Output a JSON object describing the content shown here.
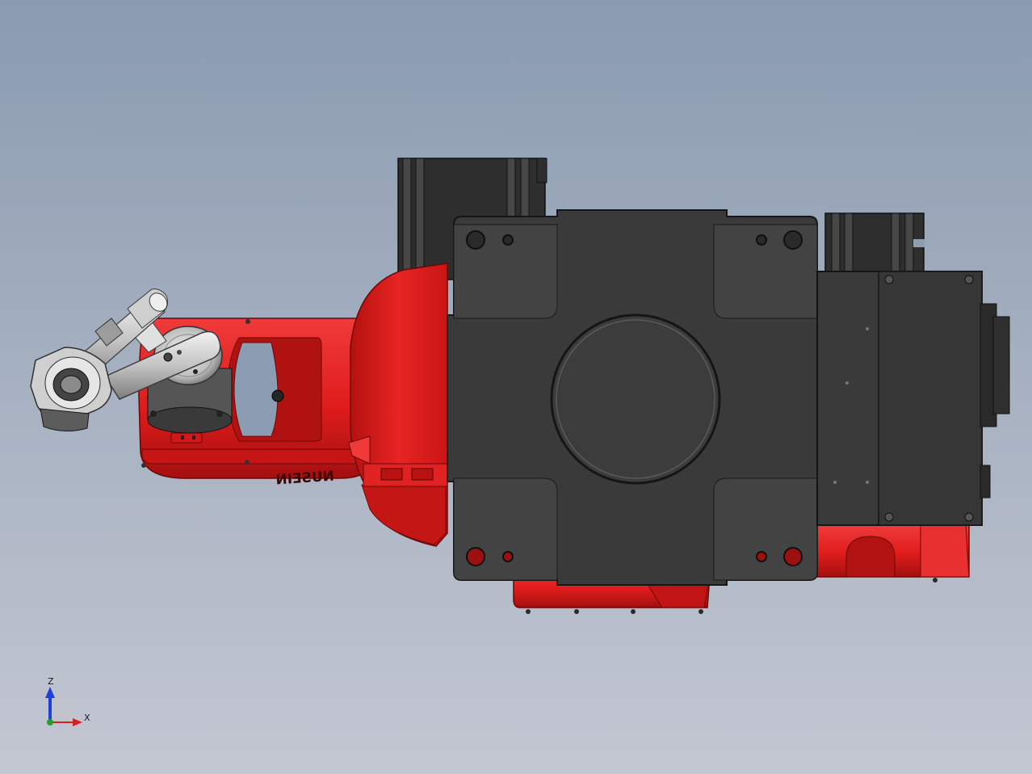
{
  "viewport": {
    "background_top": "#8a9bb0",
    "background_bottom": "#c3c7d2"
  },
  "model": {
    "arm_color": "#e01c1c",
    "arm_shadow": "#8f0c0c",
    "arm_highlight": "#f04545",
    "base_color": "#3a3a3a",
    "base_edge": "#1c1c1c",
    "tool_color": "#d8d8d8",
    "lettering": "NUSEIN"
  },
  "triad": {
    "z_label": "Z",
    "x_label": "X",
    "z_color": "#1f3fd8",
    "x_color": "#d82020",
    "y_color": "#20a030"
  }
}
